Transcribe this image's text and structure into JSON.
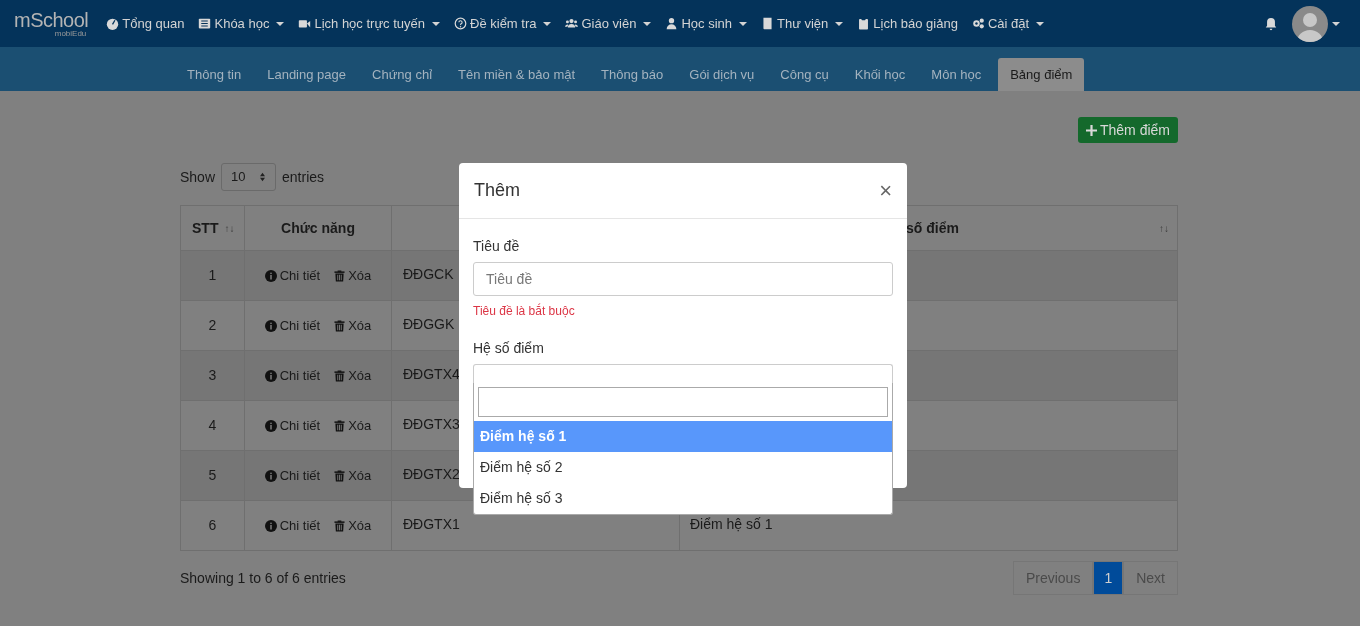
{
  "logo": {
    "name": "mSchool",
    "sub": "mobiEdu"
  },
  "nav": [
    {
      "label": "Tổng quan",
      "caret": false
    },
    {
      "label": "Khóa học",
      "caret": true
    },
    {
      "label": "Lịch học trực tuyến",
      "caret": true
    },
    {
      "label": "Đề kiểm tra",
      "caret": true
    },
    {
      "label": "Giáo viên",
      "caret": true
    },
    {
      "label": "Học sinh",
      "caret": true
    },
    {
      "label": "Thư viện",
      "caret": true
    },
    {
      "label": "Lịch báo giảng",
      "caret": false
    },
    {
      "label": "Cài đặt",
      "caret": true
    }
  ],
  "tabs": [
    {
      "label": "Thông tin",
      "selected": false
    },
    {
      "label": "Landing page",
      "selected": false
    },
    {
      "label": "Chứng chỉ",
      "selected": false
    },
    {
      "label": "Tên miền & bảo mật",
      "selected": false
    },
    {
      "label": "Thông báo",
      "selected": false
    },
    {
      "label": "Gói dịch vụ",
      "selected": false
    },
    {
      "label": "Công cụ",
      "selected": false
    },
    {
      "label": "Khối học",
      "selected": false
    },
    {
      "label": "Môn học",
      "selected": false
    },
    {
      "label": "Bảng điểm",
      "selected": true
    }
  ],
  "add_button": "Thêm điểm",
  "length": {
    "show": "Show",
    "value": "10",
    "entries": "entries"
  },
  "table": {
    "columns": [
      {
        "label": "STT",
        "sort": "↑↓"
      },
      {
        "label": "Chức năng"
      },
      {},
      {
        "label": "số điểm",
        "sort": "↑↓"
      }
    ],
    "rows": [
      {
        "stt": "1",
        "detail": "Chi tiết",
        "delete": "Xóa",
        "title": "ĐĐGCK"
      },
      {
        "stt": "2",
        "detail": "Chi tiết",
        "delete": "Xóa",
        "title": "ĐĐGGK"
      },
      {
        "stt": "3",
        "detail": "Chi tiết",
        "delete": "Xóa",
        "title": "ĐĐGTX4"
      },
      {
        "stt": "4",
        "detail": "Chi tiết",
        "delete": "Xóa",
        "title": "ĐĐGTX3"
      },
      {
        "stt": "5",
        "detail": "Chi tiết",
        "delete": "Xóa",
        "title": "ĐĐGTX2"
      },
      {
        "stt": "6",
        "detail": "Chi tiết",
        "delete": "Xóa",
        "title": "ĐĐGTX1",
        "coef": "Điểm hệ số 1"
      }
    ]
  },
  "info": "Showing 1 to 6 of 6 entries",
  "pagination": [
    {
      "label": "Previous",
      "kind": "nav",
      "selected": false
    },
    {
      "label": "1",
      "kind": "page",
      "selected": true
    },
    {
      "label": "Next",
      "kind": "nav",
      "selected": false
    }
  ],
  "modal": {
    "title": "Thêm",
    "close": "×",
    "title_label": "Tiêu đề",
    "title_placeholder": "Tiêu đề",
    "error": "Tiêu đề là bắt buộc",
    "coef_label": "Hệ số điểm",
    "options": [
      {
        "label": "Điểm hệ số 1",
        "selected": true
      },
      {
        "label": "Điểm hệ số 2",
        "selected": false
      },
      {
        "label": "Điểm hệ số 3",
        "selected": false
      }
    ]
  }
}
